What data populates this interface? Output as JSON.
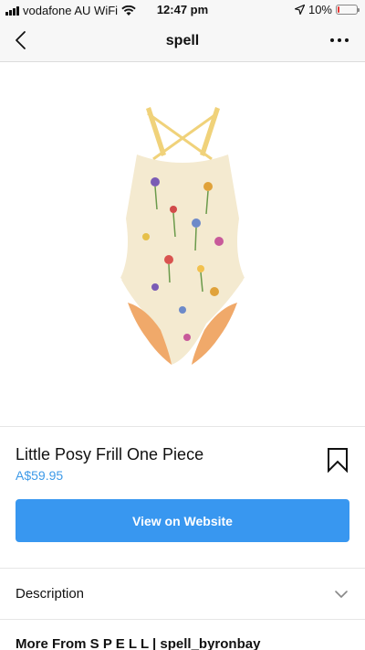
{
  "status_bar": {
    "carrier": "vodafone AU WiFi",
    "time": "12:47 pm",
    "battery": "10%",
    "battery_level": 0.1
  },
  "nav": {
    "title": "spell",
    "back_icon": "chevron-left-icon",
    "more_icon": "more-dots-icon"
  },
  "product": {
    "image_alt": "floral swimsuit",
    "name": "Little Posy Frill One Piece",
    "price": "A$59.95",
    "bookmark_icon": "bookmark-icon",
    "button_label": "View on Website",
    "accent_color": "#3897f0"
  },
  "description": {
    "label": "Description",
    "icon": "chevron-down-icon"
  },
  "more_from": {
    "label": "More From S P E L L | spell_byronbay"
  }
}
